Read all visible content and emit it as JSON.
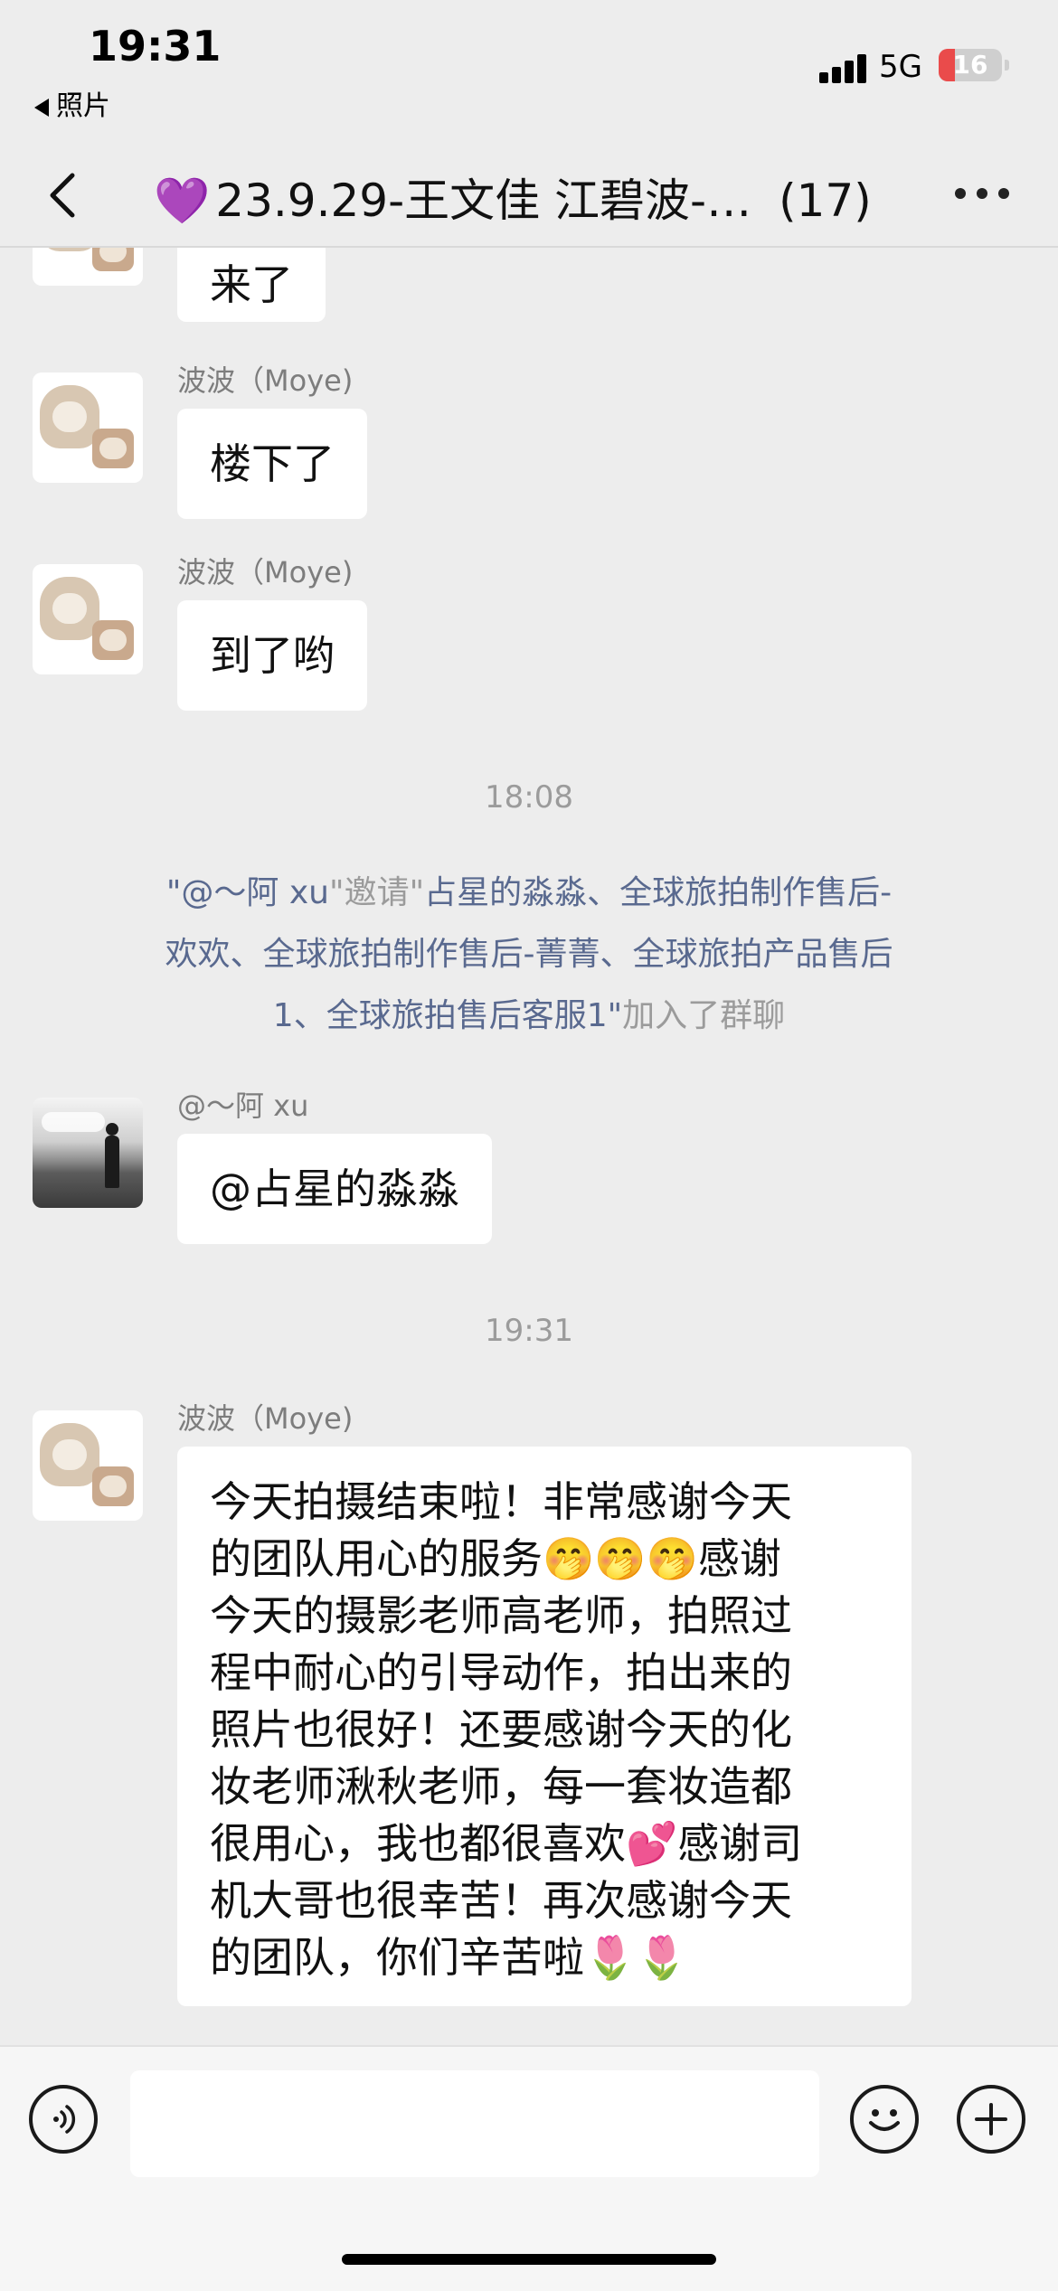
{
  "status_bar": {
    "time": "19:31",
    "back_app": "照片",
    "network": "5G",
    "battery": "16"
  },
  "nav": {
    "title_icon": "💜",
    "title": "23.9.29-王文佳 江碧波-…",
    "member_count": "(17)"
  },
  "messages": [
    {
      "type": "text",
      "avatar": "cat",
      "text": "来了"
    },
    {
      "type": "text",
      "avatar": "cat",
      "sender": "波波（Moye)",
      "text": "楼下了"
    },
    {
      "type": "text",
      "avatar": "cat",
      "sender": "波波（Moye)",
      "text": "到了哟"
    },
    {
      "type": "time",
      "text": "18:08"
    },
    {
      "type": "system",
      "line1_q1": "\"",
      "line1_inviter": "@～阿 xu",
      "line1_q2": "\"",
      "line1_invite": "邀请",
      "line1_q3": "\"",
      "line1_names": "占星的淼淼、全球旅拍制作售后-",
      "line2": "欢欢、全球旅拍制作售后-菁菁、全球旅拍产品售后",
      "line3_names": "1、全球旅拍售后客服1",
      "line3_q": "\"",
      "line3_join": "加入了群聊"
    },
    {
      "type": "text",
      "avatar": "landscape",
      "sender": "@～阿 xu",
      "text": "@占星的淼淼"
    },
    {
      "type": "time",
      "text": "19:31"
    },
    {
      "type": "text",
      "avatar": "cat",
      "sender": "波波（Moye)",
      "lines": [
        "今天拍摄结束啦！非常感谢今天",
        "的团队用心的服务🤭🤭🤭感谢",
        "今天的摄影老师高老师，拍照过",
        "程中耐心的引导动作，拍出来的",
        "照片也很好！还要感谢今天的化",
        "妆老师湫秋老师，每一套妆造都",
        "很用心，我也都很喜欢💕感谢司",
        "机大哥也很幸苦！再次感谢今天",
        "的团队，你们辛苦啦🌷🌷"
      ]
    }
  ],
  "input": {
    "value": ""
  }
}
